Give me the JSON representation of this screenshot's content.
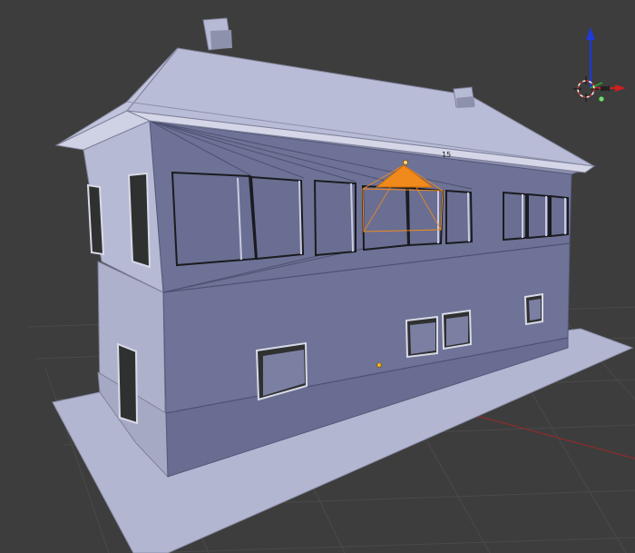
{
  "app": "3D viewport",
  "viewport": {
    "background": "#3d3d3d",
    "grid_color": "#4a4a4a",
    "x_axis_color": "#8e2c2c"
  },
  "scene": {
    "object_label": "15",
    "mesh_color": "#6e7296",
    "mesh_light_color": "#b4b8d2",
    "selection_color": "#f08a1c"
  },
  "gizmo": {
    "icons": [
      "navigation-gizmo-icon",
      "camera-icon",
      "light-icon"
    ],
    "axis_colors": {
      "x": "#cc2020",
      "y": "#2a9a2a",
      "z": "#1e3ad8"
    }
  }
}
